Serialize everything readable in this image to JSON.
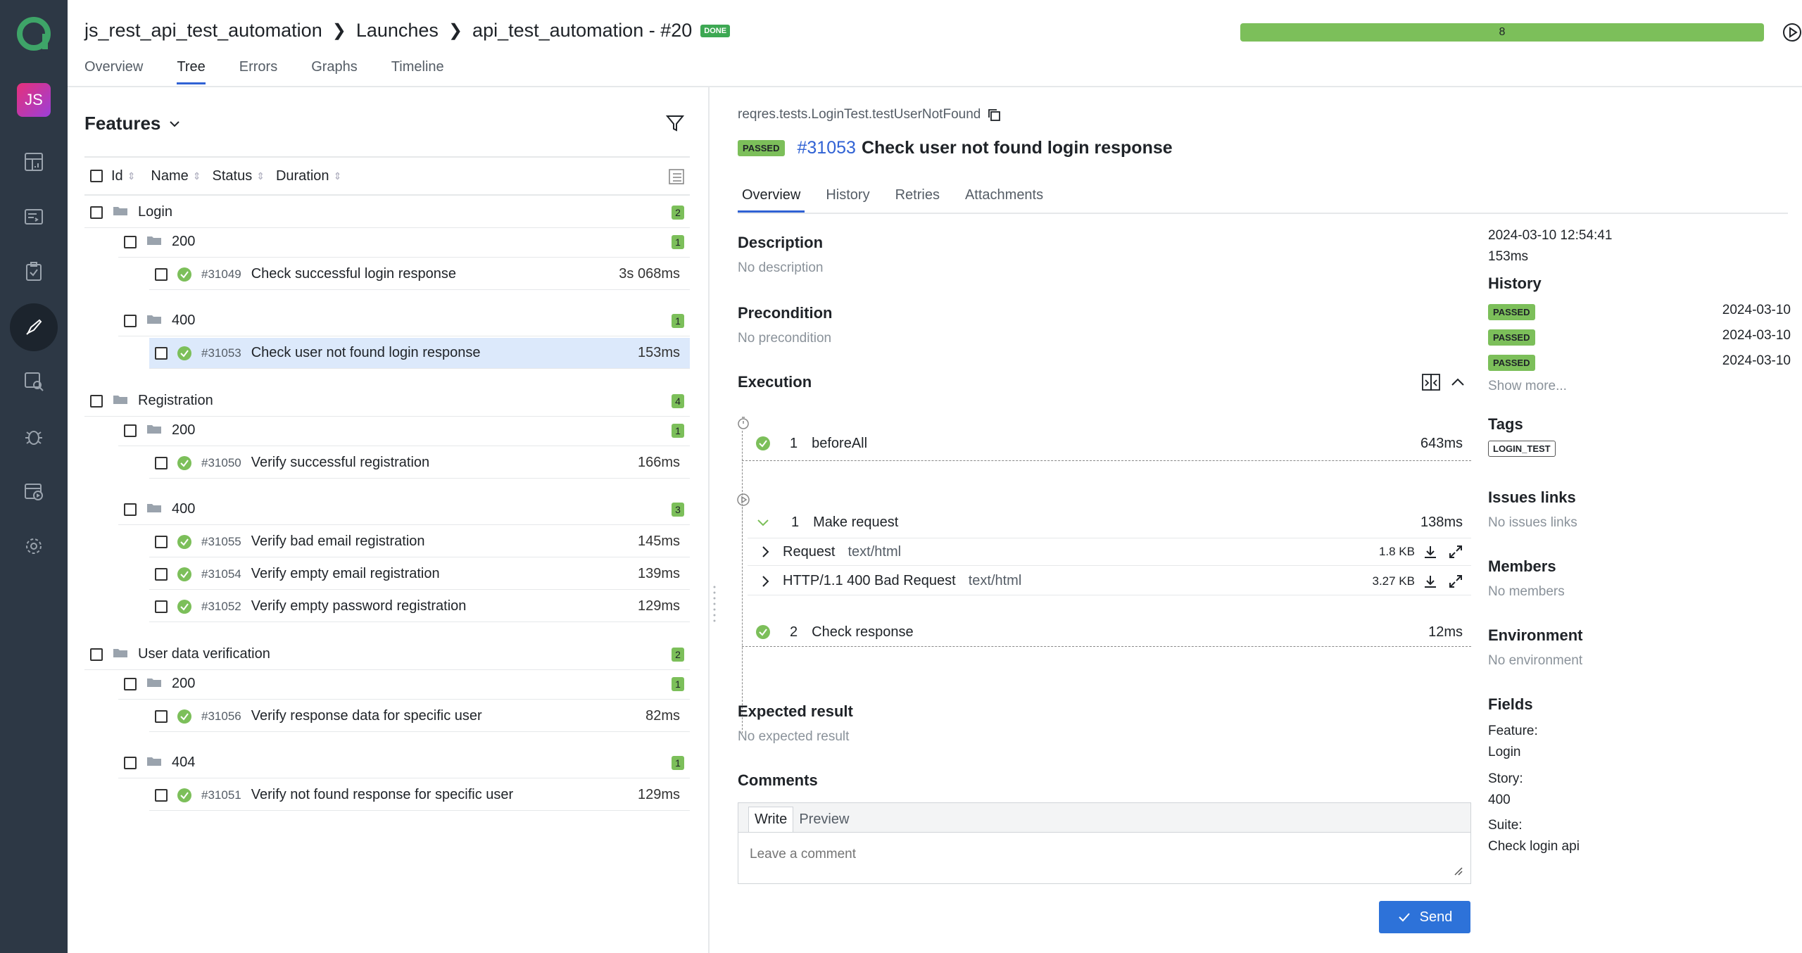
{
  "sidebar": {
    "avatar": "JS"
  },
  "header": {
    "breadcrumb": [
      "js_rest_api_test_automation",
      "Launches",
      "api_test_automation - #20"
    ],
    "status": "DONE",
    "tabs": [
      "Overview",
      "Tree",
      "Errors",
      "Graphs",
      "Timeline"
    ],
    "progress_count": "8",
    "progress_fraction": 1.0
  },
  "tree": {
    "title": "Features",
    "columns": [
      "Id",
      "Name",
      "Status",
      "Duration"
    ],
    "groups": [
      {
        "name": "Login",
        "count": "2",
        "subgroups": [
          {
            "name": "200",
            "count": "1",
            "tests": [
              {
                "id": "#31049",
                "name": "Check successful login response",
                "duration": "3s 068ms"
              }
            ]
          },
          {
            "name": "400",
            "count": "1",
            "tests": [
              {
                "id": "#31053",
                "name": "Check user not found login response",
                "duration": "153ms"
              }
            ]
          }
        ]
      },
      {
        "name": "Registration",
        "count": "4",
        "subgroups": [
          {
            "name": "200",
            "count": "1",
            "tests": [
              {
                "id": "#31050",
                "name": "Verify successful registration",
                "duration": "166ms"
              }
            ]
          },
          {
            "name": "400",
            "count": "3",
            "tests": [
              {
                "id": "#31055",
                "name": "Verify bad email registration",
                "duration": "145ms"
              },
              {
                "id": "#31054",
                "name": "Verify empty email registration",
                "duration": "139ms"
              },
              {
                "id": "#31052",
                "name": "Verify empty password registration",
                "duration": "129ms"
              }
            ]
          }
        ]
      },
      {
        "name": "User data verification",
        "count": "2",
        "subgroups": [
          {
            "name": "200",
            "count": "1",
            "tests": [
              {
                "id": "#31056",
                "name": "Verify response data for specific user",
                "duration": "82ms"
              }
            ]
          },
          {
            "name": "404",
            "count": "1",
            "tests": [
              {
                "id": "#31051",
                "name": "Verify not found response for specific user",
                "duration": "129ms"
              }
            ]
          }
        ]
      }
    ]
  },
  "detail": {
    "path": "reqres.tests.LoginTest.testUserNotFound",
    "status": "PASSED",
    "id": "#31053",
    "title": "Check user not found login response",
    "tabs": [
      "Overview",
      "History",
      "Retries",
      "Attachments"
    ],
    "description_h": "Description",
    "description": "No description",
    "precondition_h": "Precondition",
    "precondition": "No precondition",
    "execution_h": "Execution",
    "before": {
      "num": "1",
      "name": "beforeAll",
      "duration": "643ms"
    },
    "steps": [
      {
        "num": "1",
        "name": "Make request",
        "duration": "138ms"
      },
      {
        "num": "2",
        "name": "Check response",
        "duration": "12ms"
      }
    ],
    "request": {
      "label": "Request",
      "type": "text/html",
      "size": "1.8 KB"
    },
    "response": {
      "label": "HTTP/1.1 400 Bad Request",
      "type": "text/html",
      "size": "3.27 KB"
    },
    "expected_h": "Expected result",
    "expected": "No expected result",
    "comments_h": "Comments",
    "comment_tabs": [
      "Write",
      "Preview"
    ],
    "comment_placeholder": "Leave a comment",
    "send": "Send"
  },
  "meta": {
    "datetime": "2024-03-10 12:54:41",
    "duration": "153ms",
    "history_h": "History",
    "history": [
      {
        "status": "PASSED",
        "date": "2024-03-10"
      },
      {
        "status": "PASSED",
        "date": "2024-03-10"
      },
      {
        "status": "PASSED",
        "date": "2024-03-10"
      }
    ],
    "show_more": "Show more...",
    "tags_h": "Tags",
    "tag": "LOGIN_TEST",
    "issues_h": "Issues links",
    "issues": "No issues links",
    "members_h": "Members",
    "members": "No members",
    "env_h": "Environment",
    "env": "No environment",
    "fields_h": "Fields",
    "fields": [
      {
        "label": "Feature:",
        "value": "Login"
      },
      {
        "label": "Story:",
        "value": "400"
      },
      {
        "label": "Suite:",
        "value": "Check login api"
      }
    ]
  }
}
